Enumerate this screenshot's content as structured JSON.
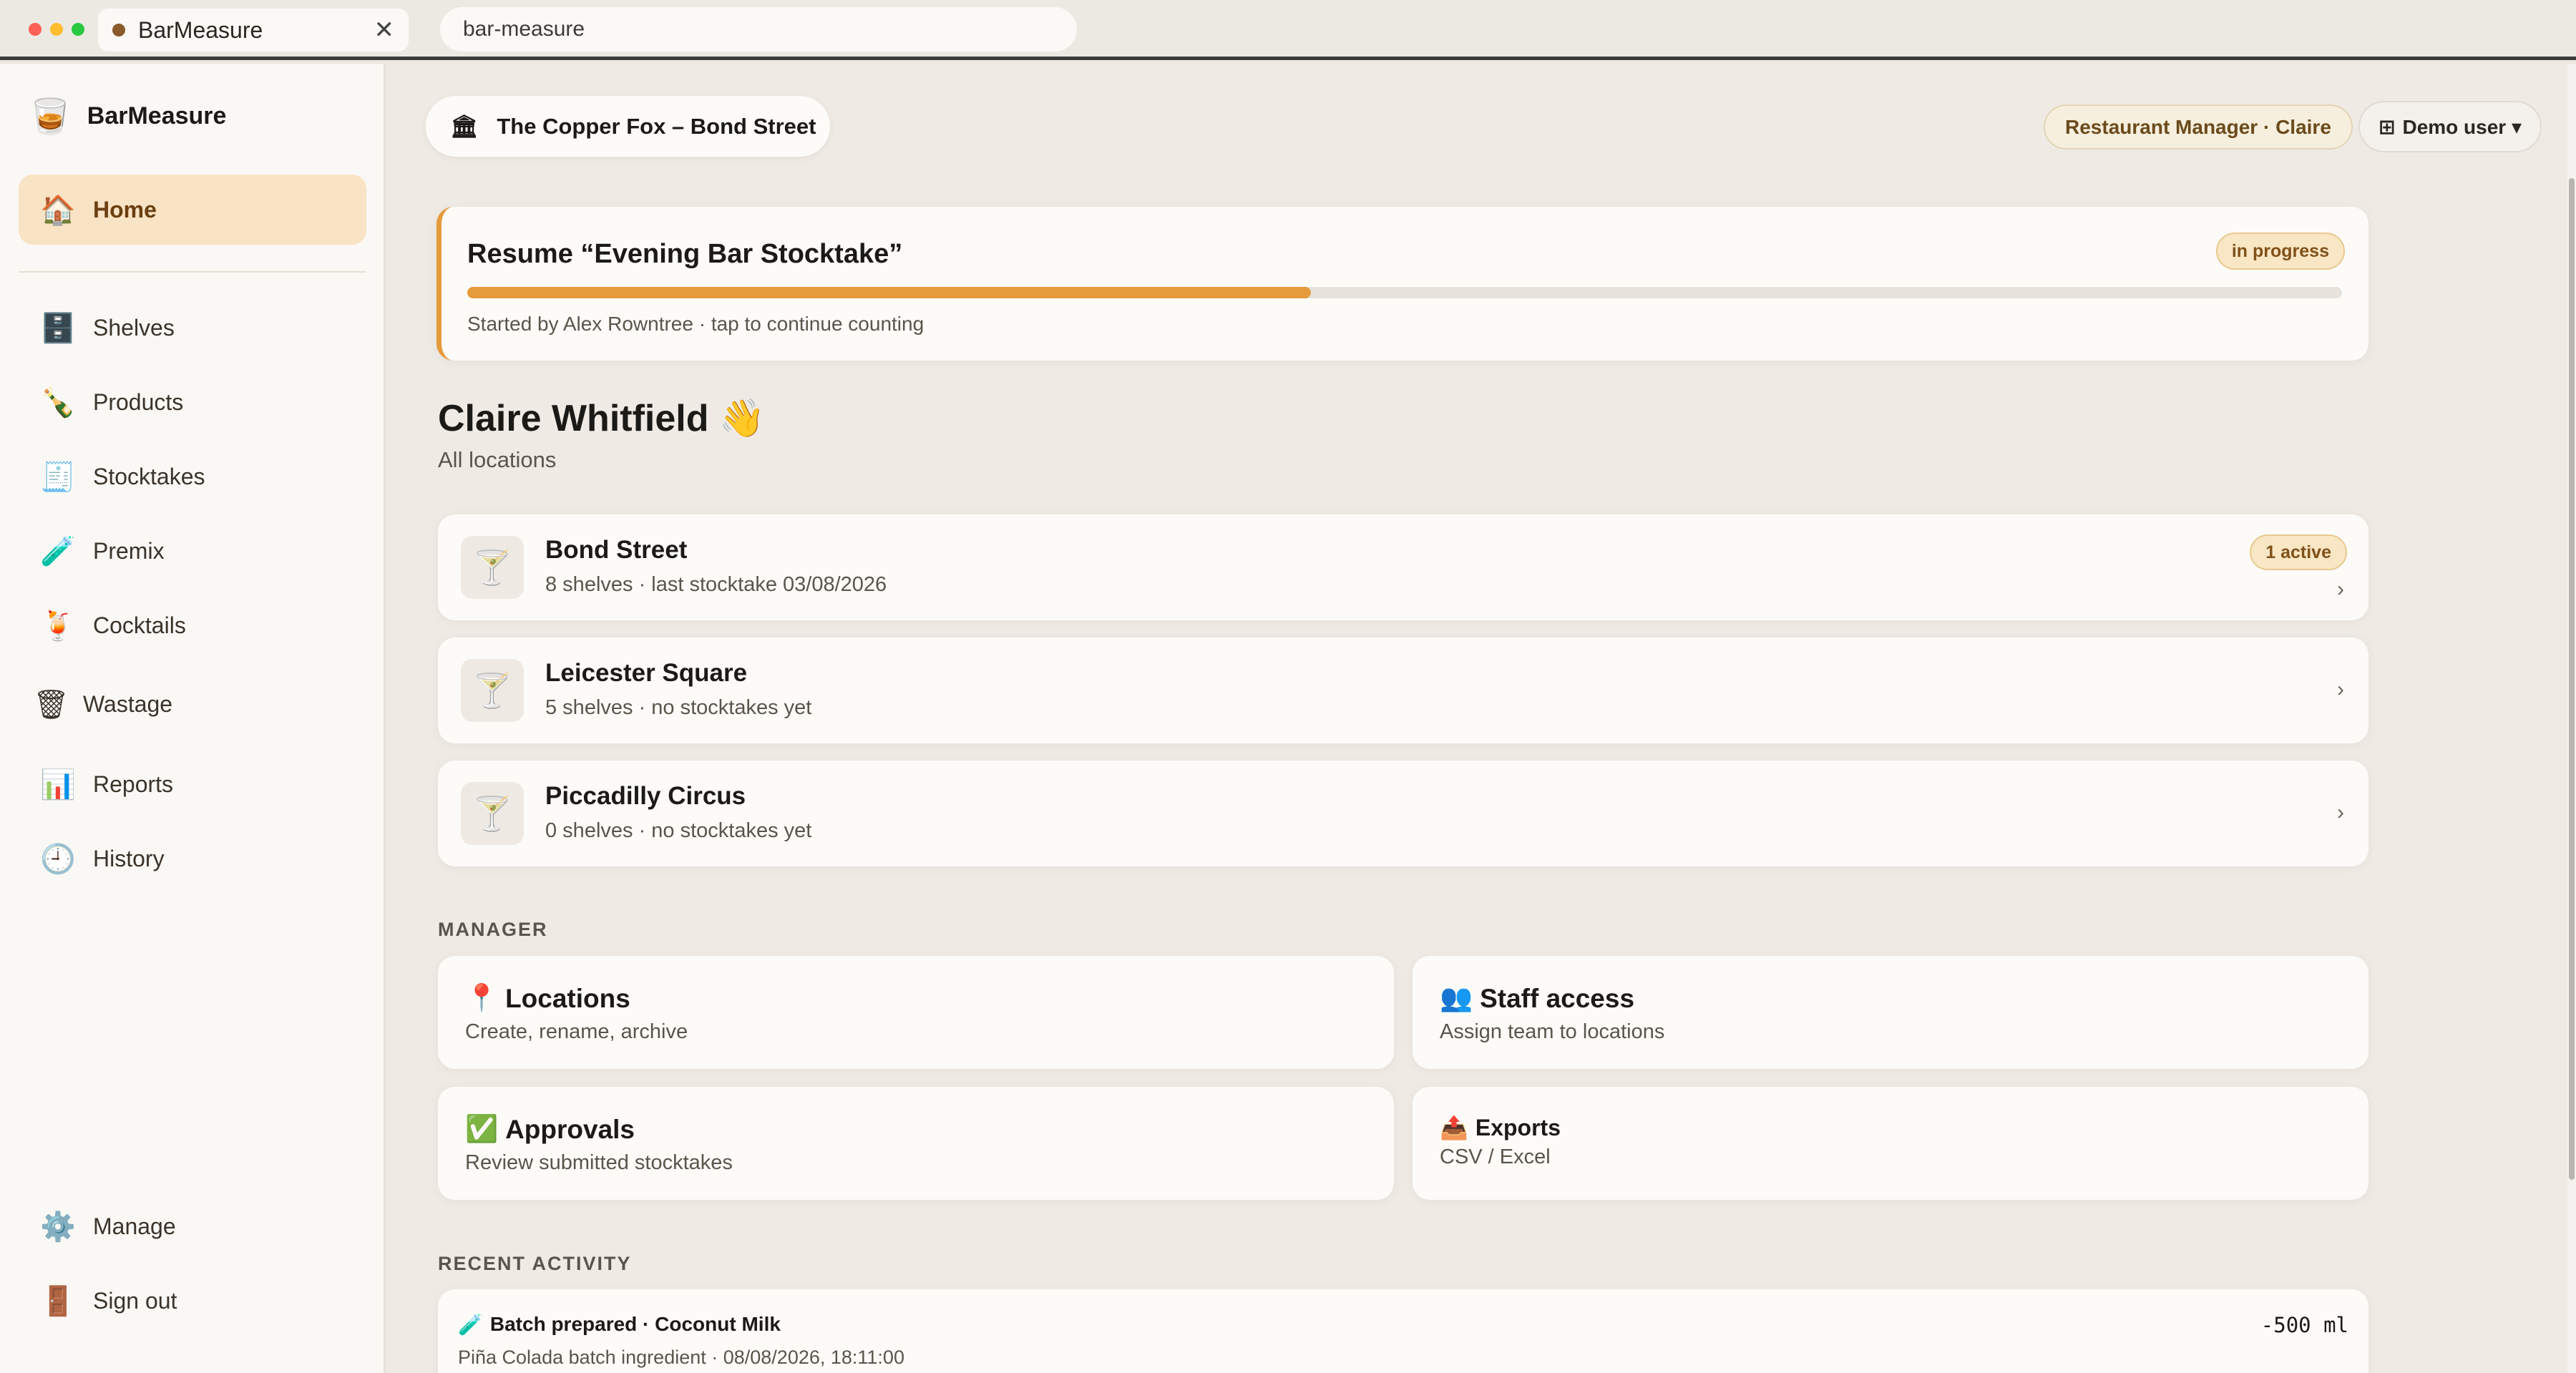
{
  "browser": {
    "tab_title": "BarMeasure",
    "url": "bar-measure",
    "traffic_colors": [
      "#ff5f57",
      "#febc2e",
      "#28c840"
    ]
  },
  "sidebar": {
    "brand": "BarMeasure",
    "items": [
      {
        "label": "Home",
        "icon": "home-icon",
        "glyph": "🏠",
        "active": true
      },
      {
        "label": "Shelves",
        "icon": "shelves-icon",
        "glyph": "🗄️"
      },
      {
        "label": "Products",
        "icon": "bottle-icon",
        "glyph": "🍾"
      },
      {
        "label": "Stocktakes",
        "icon": "receipt-icon",
        "glyph": "🧾"
      },
      {
        "label": "Premix",
        "icon": "test-tube-icon",
        "glyph": "🧪"
      },
      {
        "label": "Cocktails",
        "icon": "cocktail-icon",
        "glyph": "🍹"
      },
      {
        "label": "Wastage",
        "icon": "bin-icon",
        "glyph": "🗑"
      },
      {
        "label": "Reports",
        "icon": "chart-icon",
        "glyph": "📊"
      },
      {
        "label": "History",
        "icon": "clock-icon",
        "glyph": "🕘"
      },
      {
        "label": "Manage",
        "icon": "gear-icon",
        "glyph": "⚙️"
      },
      {
        "label": "Sign out",
        "icon": "door-icon",
        "glyph": "🚪"
      }
    ]
  },
  "header": {
    "location": "The Copper Fox – Bond Street",
    "role": "Restaurant Manager · Claire",
    "user": "Demo user ▾"
  },
  "resume": {
    "title": "Resume “Evening Bar Stocktake”",
    "badge": "in progress",
    "progress": 0.45,
    "subtitle": "Started by Alex Rowntree · tap to continue counting"
  },
  "greeting": {
    "name": "Claire Whitfield 👋",
    "subtitle": "All locations"
  },
  "locations": [
    {
      "name": "Bond Street",
      "meta": "8 shelves · last stocktake 03/08/2026",
      "badge": "1 active"
    },
    {
      "name": "Leicester Square",
      "meta": "5 shelves · no stocktakes yet"
    },
    {
      "name": "Piccadilly Circus",
      "meta": "0 shelves · no stocktakes yet"
    }
  ],
  "manager": {
    "label": "MANAGER",
    "tiles": [
      {
        "title": "Locations",
        "glyph": "📍",
        "subtitle": "Create, rename, archive"
      },
      {
        "title": "Staff access",
        "glyph": "👥",
        "subtitle": "Assign team to locations"
      },
      {
        "title": "Approvals",
        "glyph": "✅",
        "subtitle": "Review submitted stocktakes"
      },
      {
        "title": "Exports",
        "glyph": "📤",
        "subtitle": "CSV / Excel"
      }
    ]
  },
  "activity": {
    "label": "RECENT ACTIVITY",
    "items": [
      {
        "title": "Batch prepared · Coconut Milk",
        "glyph": "🧪",
        "subtitle": "Piña Colada batch ingredient · 08/08/2026, 18:11:00",
        "value": "-500 ml"
      }
    ]
  }
}
